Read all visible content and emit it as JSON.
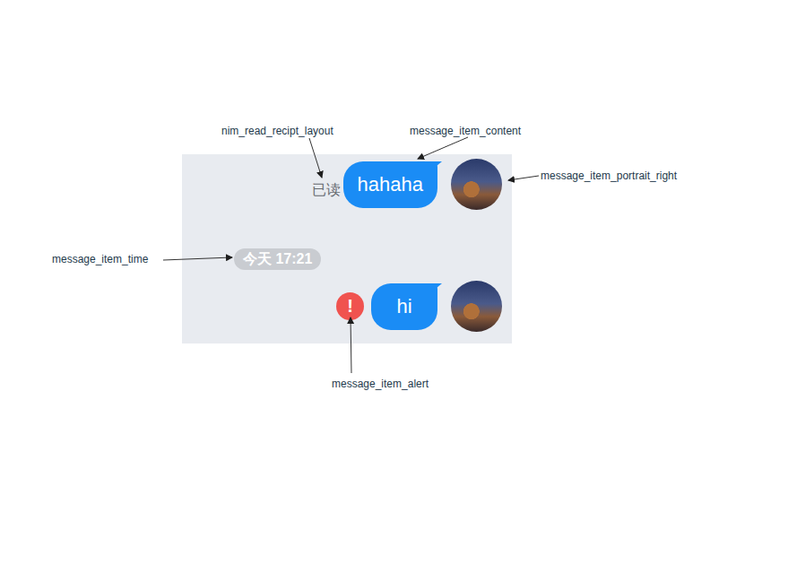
{
  "annotations": [
    {
      "label": "nim_read_recipt_layout"
    },
    {
      "label": "message_item_content"
    },
    {
      "label": "message_item_portrait_right"
    },
    {
      "label": "message_item_time"
    },
    {
      "label": "message_item_alert"
    }
  ],
  "chat": {
    "items": [
      {
        "kind": "message",
        "text": "hahaha",
        "receipt": "已读",
        "failed": false,
        "alert": ""
      },
      {
        "kind": "time",
        "text": "今天 17:21",
        "receipt": "",
        "failed": false,
        "alert": ""
      },
      {
        "kind": "message",
        "text": "hi",
        "receipt": "",
        "failed": true,
        "alert": "!"
      }
    ]
  }
}
